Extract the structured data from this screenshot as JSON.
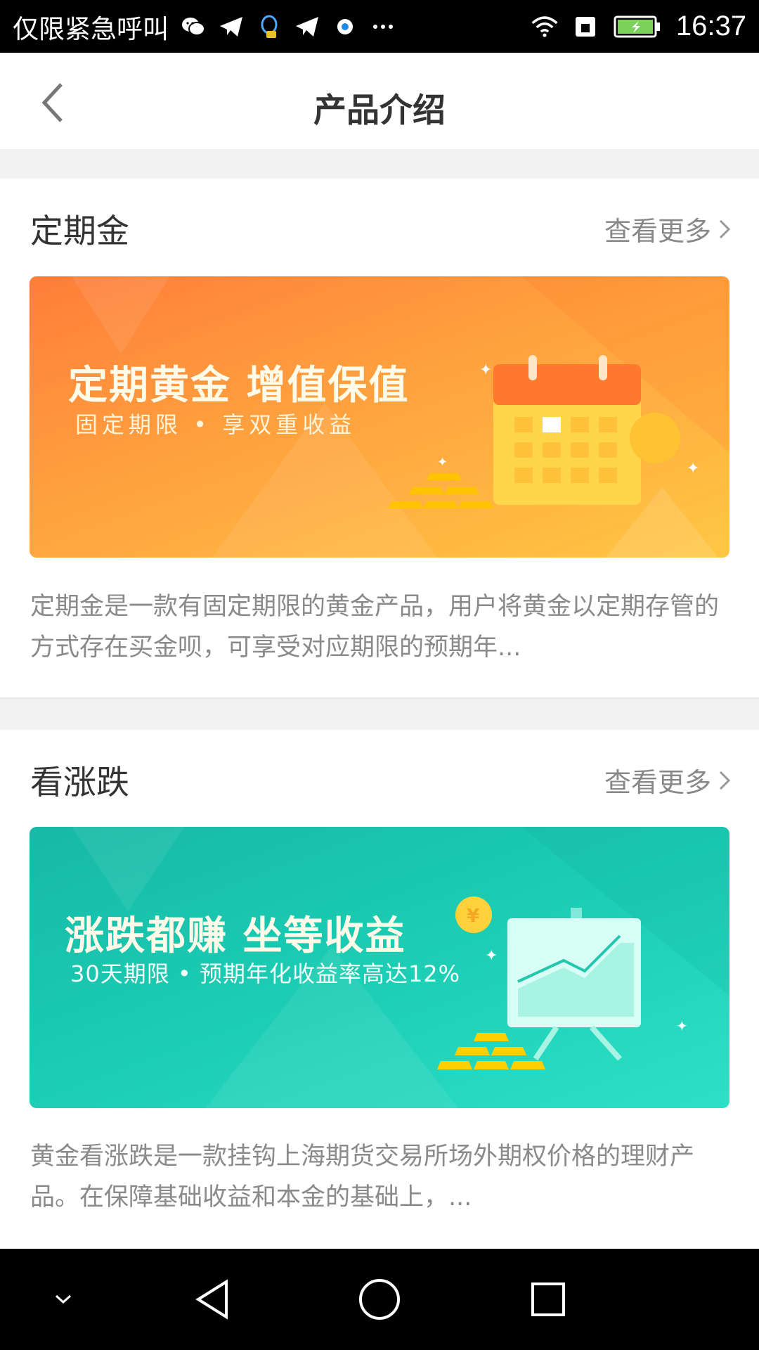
{
  "status_bar": {
    "carrier": "仅限紧急呼叫",
    "time": "16:37",
    "icons": [
      "wechat-icon",
      "telegram-icon",
      "qq-icon",
      "send-icon",
      "browser-icon",
      "more-icon",
      "wifi-icon",
      "sim-icon",
      "battery-icon"
    ]
  },
  "header": {
    "title": "产品介绍"
  },
  "sections": [
    {
      "title": "定期金",
      "more_label": "查看更多",
      "banner_headline": "定期黄金  增值保值",
      "banner_sub": "固定期限 • 享双重收益",
      "description": "定期金是一款有固定期限的黄金产品，用户将黄金以定期存管的方式存在买金呗，可享受对应期限的预期年..."
    },
    {
      "title": "看涨跌",
      "more_label": "查看更多",
      "banner_headline": "涨跌都赚  坐等收益",
      "banner_sub": "30天期限 • 预期年化收益率高达12%",
      "description": "黄金看涨跌是一款挂钩上海期货交易所场外期权价格的理财产品。在保障基础收益和本金的基础上，..."
    }
  ],
  "colors": {
    "orange_banner": "#ff8c3c",
    "teal_banner": "#1ccdb4",
    "page_gap": "#f2f2f2"
  },
  "nav_bar": {
    "buttons": [
      "collapse-icon",
      "back-triangle-icon",
      "home-circle-icon",
      "recents-square-icon"
    ]
  }
}
